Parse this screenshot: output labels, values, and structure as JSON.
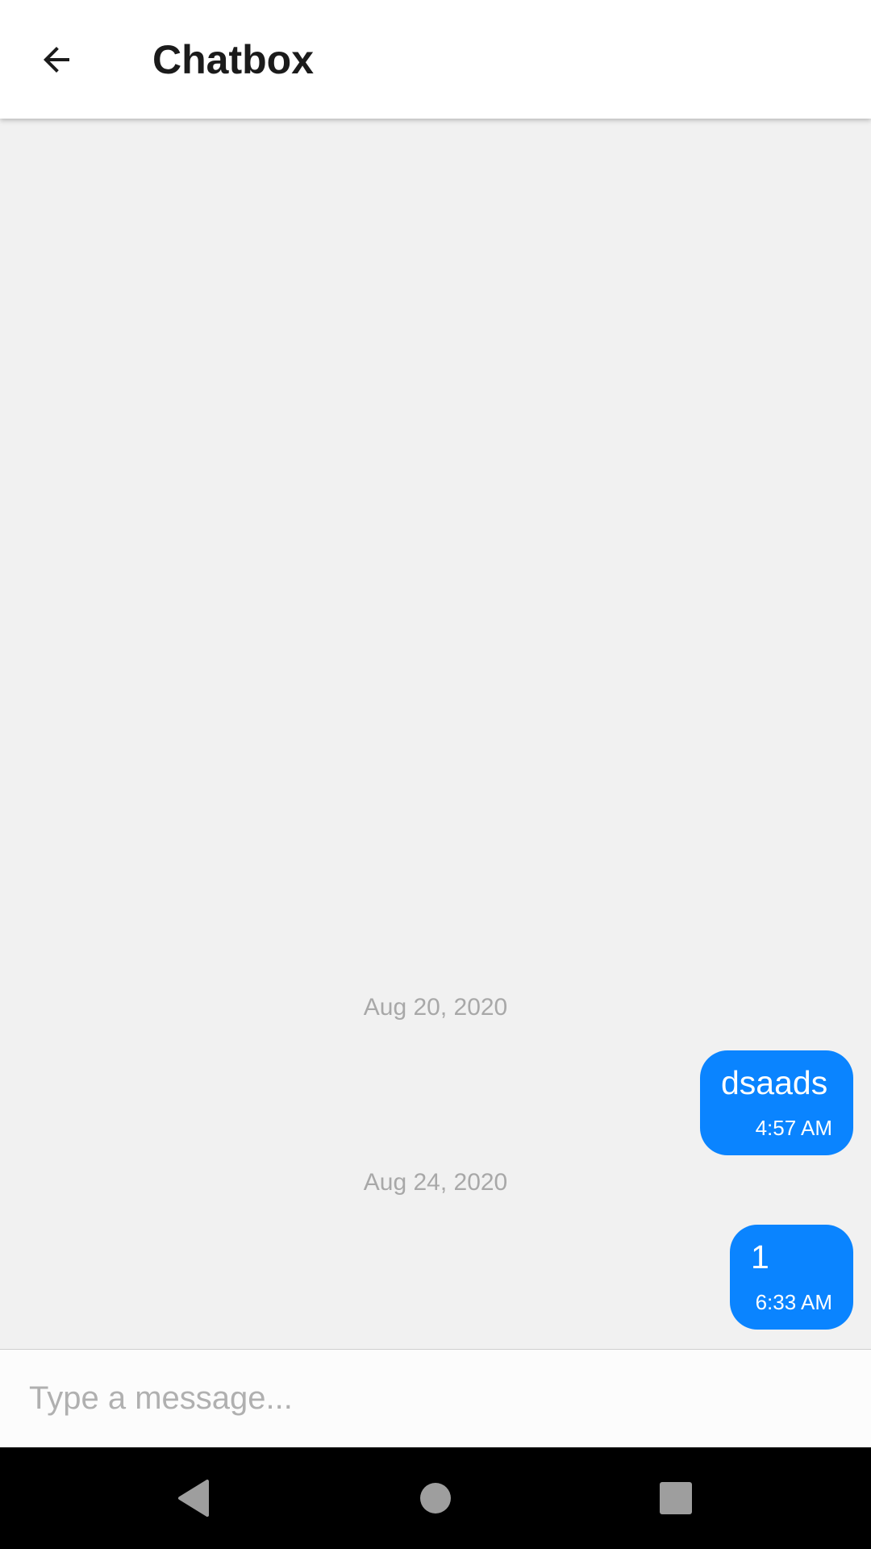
{
  "header": {
    "title": "Chatbox",
    "back_icon": "arrow-back-icon"
  },
  "messages": [
    {
      "date": "Aug 20, 2020",
      "text": "dsaads",
      "time": "4:57 AM",
      "direction": "outgoing"
    },
    {
      "date": "Aug 24, 2020",
      "text": "1",
      "time": "6:33 AM",
      "direction": "outgoing"
    }
  ],
  "composer": {
    "placeholder": "Type a message...",
    "value": ""
  },
  "colors": {
    "bubble": "#0a84ff",
    "background": "#f1f1f1",
    "date_text": "#a8a8a8"
  },
  "nav": {
    "back_icon": "nav-back-icon",
    "home_icon": "nav-home-icon",
    "recents_icon": "nav-recents-icon"
  }
}
